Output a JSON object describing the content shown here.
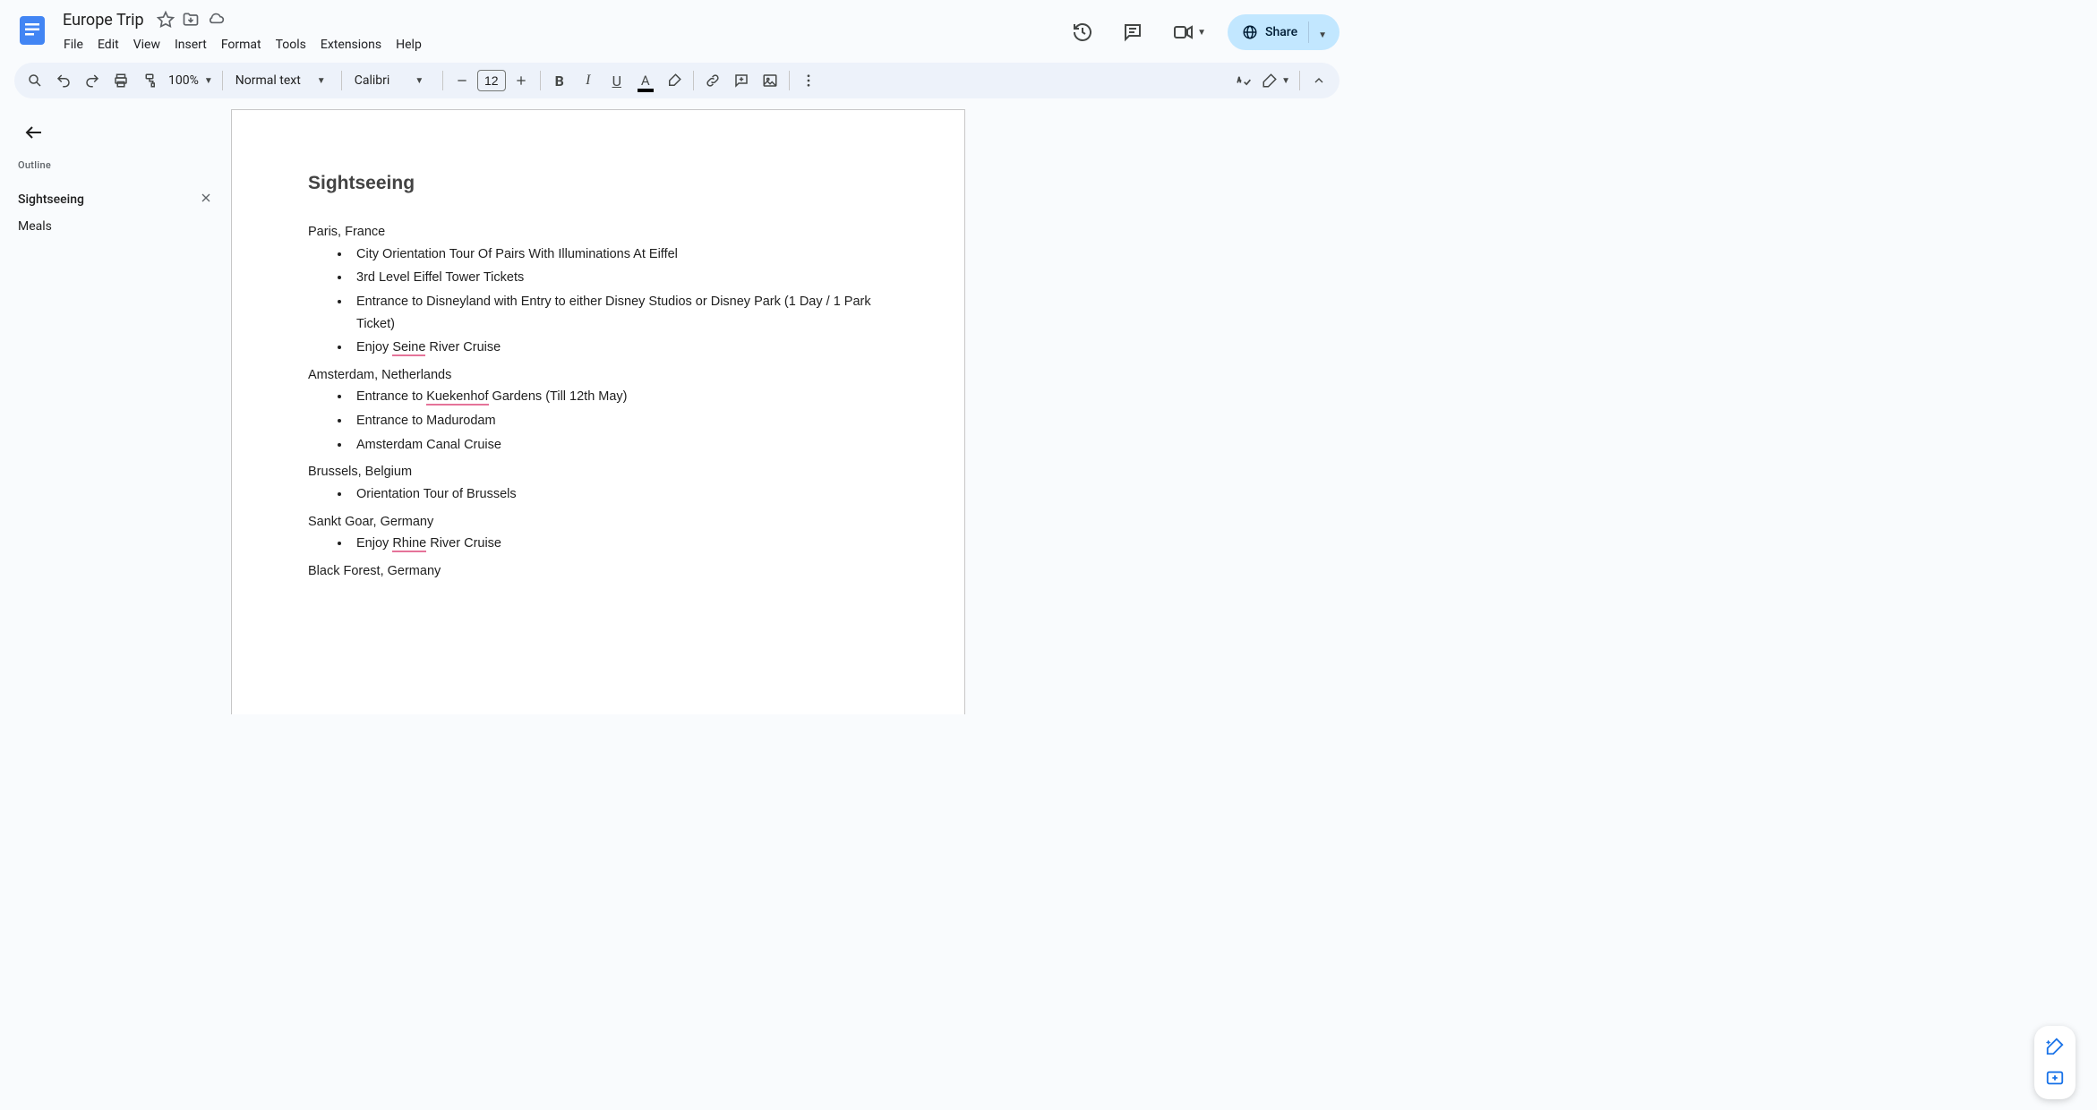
{
  "doc": {
    "title": "Europe Trip"
  },
  "menus": {
    "file": "File",
    "edit": "Edit",
    "view": "View",
    "insert": "Insert",
    "format": "Format",
    "tools": "Tools",
    "extensions": "Extensions",
    "help": "Help"
  },
  "share": {
    "label": "Share"
  },
  "toolbar": {
    "zoom": "100%",
    "paragraph_style": "Normal text",
    "font_family": "Calibri",
    "font_size": "12"
  },
  "outline": {
    "label": "Outline",
    "items": [
      {
        "label": "Sightseeing",
        "active": true
      },
      {
        "label": "Meals",
        "active": false
      }
    ]
  },
  "content": {
    "heading": "Sightseeing",
    "sections": [
      {
        "location": "Paris, France",
        "items": [
          {
            "pre": "City Orientation Tour Of Pairs With Illuminations At Eiffel"
          },
          {
            "pre": "3rd Level Eiffel Tower Tickets"
          },
          {
            "pre": "Entrance to Disneyland with Entry to either Disney Studios or Disney Park (1 Day / 1 Park Ticket)"
          },
          {
            "pre": "Enjoy ",
            "err": "Seine",
            "post": " River Cruise"
          }
        ]
      },
      {
        "location": "Amsterdam, Netherlands",
        "items": [
          {
            "pre": "Entrance to ",
            "err": "Kuekenhof",
            "post": " Gardens (Till 12th May)"
          },
          {
            "pre": "Entrance to Madurodam"
          },
          {
            "pre": "Amsterdam Canal Cruise"
          }
        ]
      },
      {
        "location": "Brussels, Belgium",
        "items": [
          {
            "pre": "Orientation Tour of Brussels"
          }
        ]
      },
      {
        "location": "Sankt Goar, Germany",
        "items": [
          {
            "pre": "Enjoy ",
            "err": "Rhine",
            "post": " River Cruise"
          }
        ]
      },
      {
        "location": "Black Forest, Germany",
        "items": []
      }
    ]
  }
}
